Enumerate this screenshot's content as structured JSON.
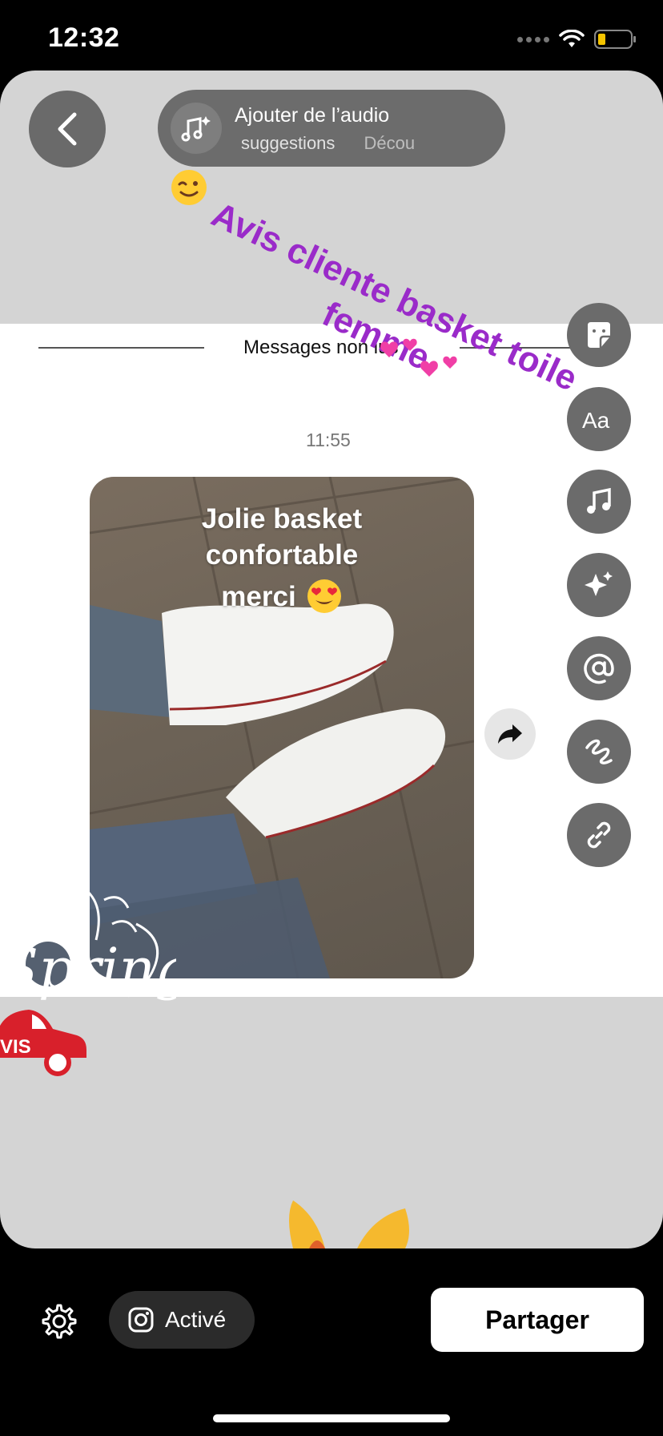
{
  "status": {
    "time": "12:32"
  },
  "header": {
    "audio_title": "Ajouter de l’audio",
    "audio_tabs": [
      "suggestions",
      "Décou"
    ]
  },
  "story": {
    "sticker_text": "Avis cliente basket toile femme",
    "divider_text": "Messages non lus",
    "message_time": "11:55",
    "photo_caption": [
      "Jolie basket",
      "confortable",
      "merci"
    ],
    "spring_text": "Spring",
    "car_text": "VIS"
  },
  "tools": [
    "sticker-icon",
    "text-icon",
    "music-icon",
    "effects-icon",
    "mention-icon",
    "draw-icon",
    "link-icon"
  ],
  "footer": {
    "active_label": "Activé",
    "share_label": "Partager"
  },
  "colors": {
    "sticker_text": "#9a2bc9",
    "canvas": "#d4d4d4",
    "car": "#d8202b"
  }
}
